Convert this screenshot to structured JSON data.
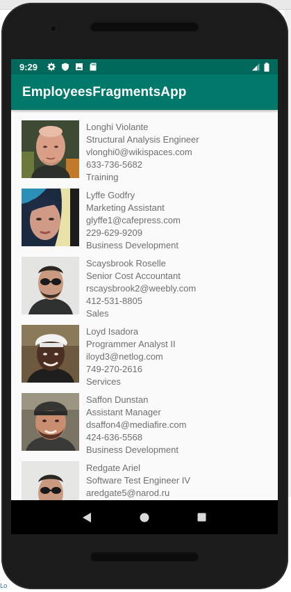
{
  "status_bar": {
    "time": "9:29",
    "left_icons": [
      "gear-icon",
      "shield-icon",
      "photo-icon",
      "sd-card-icon"
    ],
    "right_icons": [
      "signal-icon",
      "battery-icon"
    ]
  },
  "app_bar": {
    "title": "EmployeesFragmentsApp"
  },
  "colors": {
    "status_bar": "#00695c",
    "app_bar": "#00796b",
    "list_background": "#fafafa",
    "text": "#6f6f6f"
  },
  "employees": [
    {
      "name": "Longhi Violante",
      "title": "Structural Analysis Engineer",
      "email": "vlonghi0@wikispaces.com",
      "phone": "633-736-5682",
      "department": "Training"
    },
    {
      "name": "Lyffe Godfry",
      "title": "Marketing Assistant",
      "email": "glyffe1@cafepress.com",
      "phone": "229-629-9209",
      "department": "Business Development"
    },
    {
      "name": "Scaysbrook Roselle",
      "title": "Senior Cost Accountant",
      "email": "rscaysbrook2@weebly.com",
      "phone": "412-531-8805",
      "department": "Sales"
    },
    {
      "name": "Loyd Isadora",
      "title": "Programmer Analyst II",
      "email": "iloyd3@netlog.com",
      "phone": "749-270-2616",
      "department": "Services"
    },
    {
      "name": "Saffon Dunstan",
      "title": "Assistant Manager",
      "email": "dsaffon4@mediafire.com",
      "phone": "424-636-5568",
      "department": "Business Development"
    },
    {
      "name": "Redgate Ariel",
      "title": "Software Test Engineer IV",
      "email": "aredgate5@narod.ru",
      "phone": "",
      "department": ""
    }
  ],
  "navigation_bar": {
    "buttons": [
      "back-icon",
      "home-icon",
      "recents-icon"
    ]
  },
  "host_window": {
    "link_fragment": "Lo"
  }
}
